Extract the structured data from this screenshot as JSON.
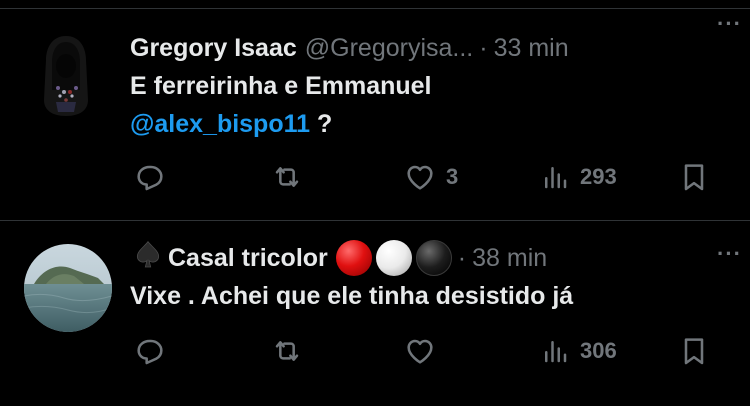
{
  "colors": {
    "background": "#000000",
    "text": "#e7e9ea",
    "muted": "#71767b",
    "link": "#1d9bf0",
    "divider": "#2f3336"
  },
  "tweets": [
    {
      "name": "Gregory Isaac",
      "handle": "@Gregoryisa...",
      "dot": "·",
      "time": "33 min",
      "more": "···",
      "text_line1": "E ferreirinha e Emmanuel",
      "mention": "@alex_bispo11",
      "text_after_mention": " ?",
      "replies": "",
      "retweets": "",
      "likes": "3",
      "views": "293"
    },
    {
      "name": "Casal tricolor",
      "name_emojis": [
        "spade",
        "red-circle",
        "white-circle",
        "black-circle"
      ],
      "dot": "·",
      "time": "38 min",
      "more": "···",
      "text_line1": "Vixe . Achei que ele tinha desistido já",
      "replies": "",
      "retweets": "",
      "likes": "",
      "views": "306"
    }
  ],
  "icons": [
    "reply-icon",
    "retweet-icon",
    "like-icon",
    "views-icon",
    "bookmark-icon",
    "more-icon"
  ]
}
